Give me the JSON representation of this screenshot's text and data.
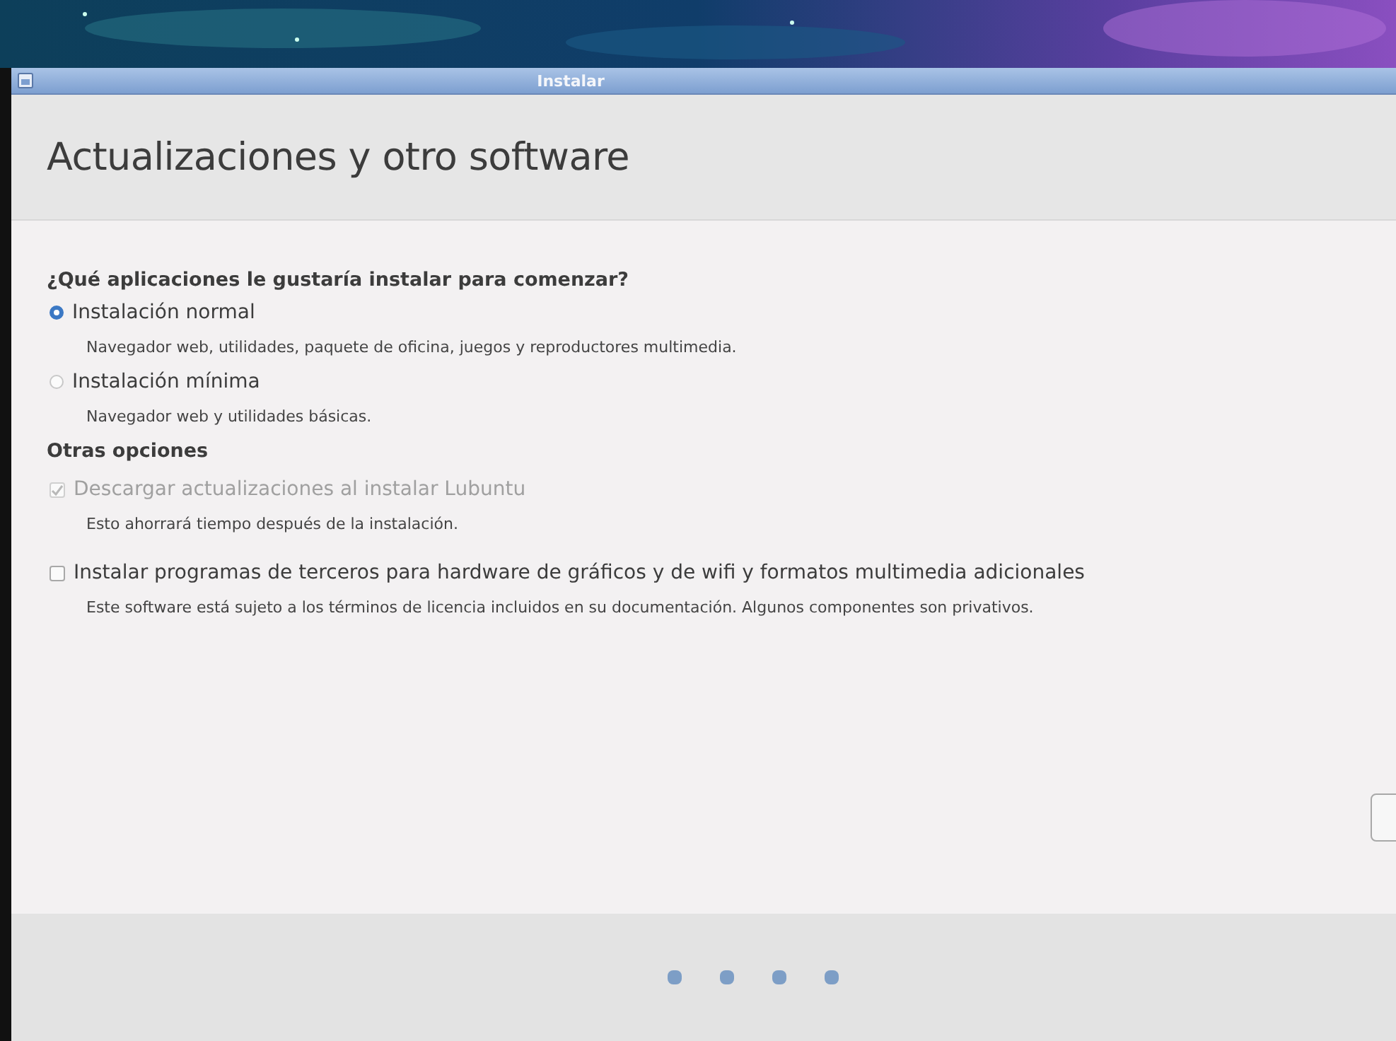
{
  "window": {
    "title": "Instalar"
  },
  "heading": "Actualizaciones y otro software",
  "install_section": {
    "question": "¿Qué aplicaciones le gustaría instalar para comenzar?",
    "options": [
      {
        "label": "Instalación normal",
        "description": "Navegador web, utilidades, paquete de oficina, juegos y reproductores multimedia.",
        "selected": true
      },
      {
        "label": "Instalación mínima",
        "description": "Navegador web y utilidades básicas.",
        "selected": false
      }
    ]
  },
  "other_section": {
    "title": "Otras opciones",
    "options": [
      {
        "label": "Descargar actualizaciones al instalar Lubuntu",
        "description": "Esto ahorrará tiempo después de la instalación.",
        "checked": true,
        "disabled": true
      },
      {
        "label": "Instalar programas de terceros para hardware de gráficos y de wifi y formatos multimedia adicionales",
        "description": "Este software está sujeto a los términos de licencia incluidos en su documentación. Algunos componentes son privativos.",
        "checked": false,
        "disabled": false
      }
    ]
  }
}
